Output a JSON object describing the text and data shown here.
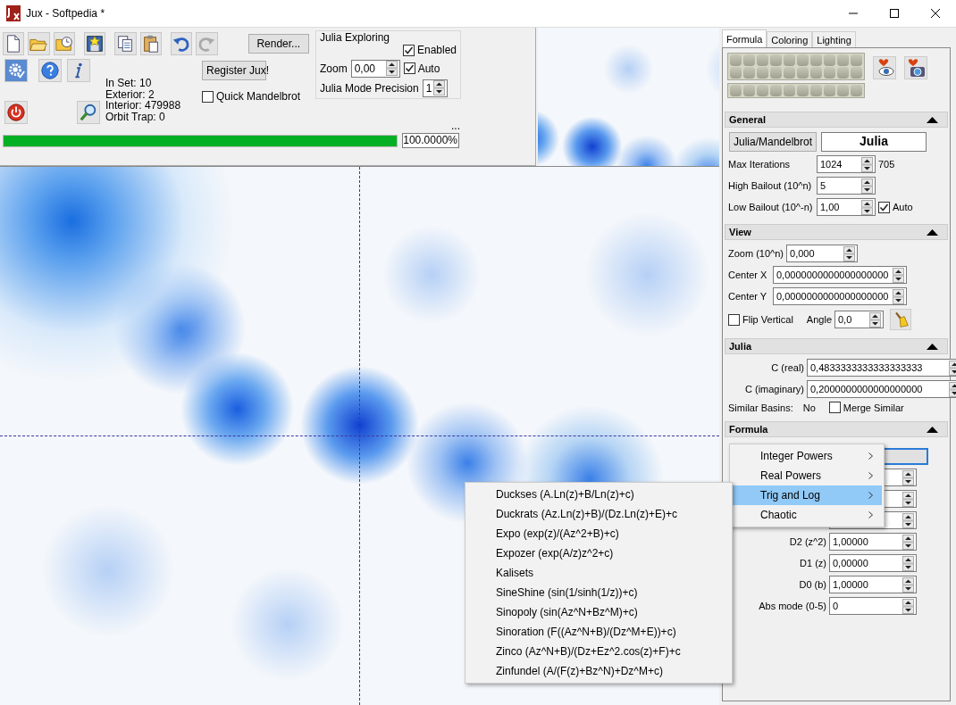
{
  "window": {
    "title": "Jux - Softpedia *"
  },
  "toolbar": {
    "render_button": "Render...",
    "register_button": "Register Jux!",
    "stats": [
      "In Set: 10",
      "Exterior: 2",
      "Interior: 479988",
      "Orbit Trap: 0"
    ],
    "quick_mandelbrot": {
      "label": "Quick Mandelbrot",
      "checked": false
    },
    "julia_exploring": {
      "title": "Julia Exploring",
      "enabled": {
        "label": "Enabled",
        "checked": true
      },
      "zoom_label": "Zoom",
      "zoom_value": "0,00",
      "auto": {
        "label": "Auto",
        "checked": true
      },
      "precision_label": "Julia Mode Precision",
      "precision_value": "1"
    },
    "ellipsis": "...",
    "progress": {
      "level": 1.0,
      "reading": "100.0000%"
    }
  },
  "tabs": [
    {
      "label": "Formula",
      "selected": true
    },
    {
      "label": "Coloring",
      "selected": false
    },
    {
      "label": "Lighting",
      "selected": false
    }
  ],
  "general": {
    "title": "General",
    "mode_button": "Julia/Mandelbrot",
    "mode_value": "Julia",
    "max_iterations": {
      "label": "Max Iterations",
      "value": "1024",
      "reading": "705"
    },
    "high_bailout": {
      "label": "High Bailout (10^n)",
      "value": "5"
    },
    "low_bailout": {
      "label": "Low Bailout (10^-n)",
      "value": "1,00",
      "auto": {
        "label": "Auto",
        "checked": true
      }
    }
  },
  "view": {
    "title": "View",
    "zoom": {
      "label": "Zoom (10^n)",
      "value": "0,000"
    },
    "center_x": {
      "label": "Center X",
      "value": "0,0000000000000000000"
    },
    "center_y": {
      "label": "Center Y",
      "value": "0,0000000000000000000"
    },
    "flip_vertical": {
      "label": "Flip Vertical",
      "checked": false
    },
    "angle": {
      "label": "Angle",
      "value": "0,0"
    }
  },
  "julia": {
    "title": "Julia",
    "c_real": {
      "label": "C (real)",
      "value": "0,4833333333333333333"
    },
    "c_imaginary": {
      "label": "C (imaginary)",
      "value": "0,2000000000000000000"
    },
    "similar_basins_label": "Similar Basins:",
    "similar_basins_value": "No",
    "merge_similar": {
      "label": "Merge Similar",
      "checked": false
    }
  },
  "formula": {
    "title": "Formula",
    "params": [
      {
        "label": "D2 (z^2)",
        "value": "1,00000"
      },
      {
        "label": "D1 (z)",
        "value": "0,00000"
      },
      {
        "label": "D0 (b)",
        "value": "1,00000"
      },
      {
        "label": "Abs mode (0-5)",
        "value": "0"
      }
    ]
  },
  "formula_menu": [
    {
      "label": "Integer Powers",
      "selected": false
    },
    {
      "label": "Real Powers",
      "selected": false
    },
    {
      "label": "Trig and Log",
      "selected": true
    },
    {
      "label": "Chaotic",
      "selected": false
    }
  ],
  "trig_submenu": [
    "Duckses (A.Ln(z)+B/Ln(z)+c)",
    "Duckrats (Az.Ln(z)+B)/(Dz.Ln(z)+E)+c",
    "Expo (exp(z)/(Az^2+B)+c)",
    "Expozer (exp(A/z)z^2+c)",
    "Kalisets",
    "SineShine (sin(1/sinh(1/z))+c)",
    "Sinopoly (sin(Az^N+Bz^M)+c)",
    "Sinoration (F((Az^N+B)/(Dz^M+E))+c)",
    "Zinco (Az^N+B)/(Dz+Ez^2.cos(z)+F)+c",
    "Zinfundel (A/(F(z)+Bz^N)+Dz^M+c)"
  ]
}
